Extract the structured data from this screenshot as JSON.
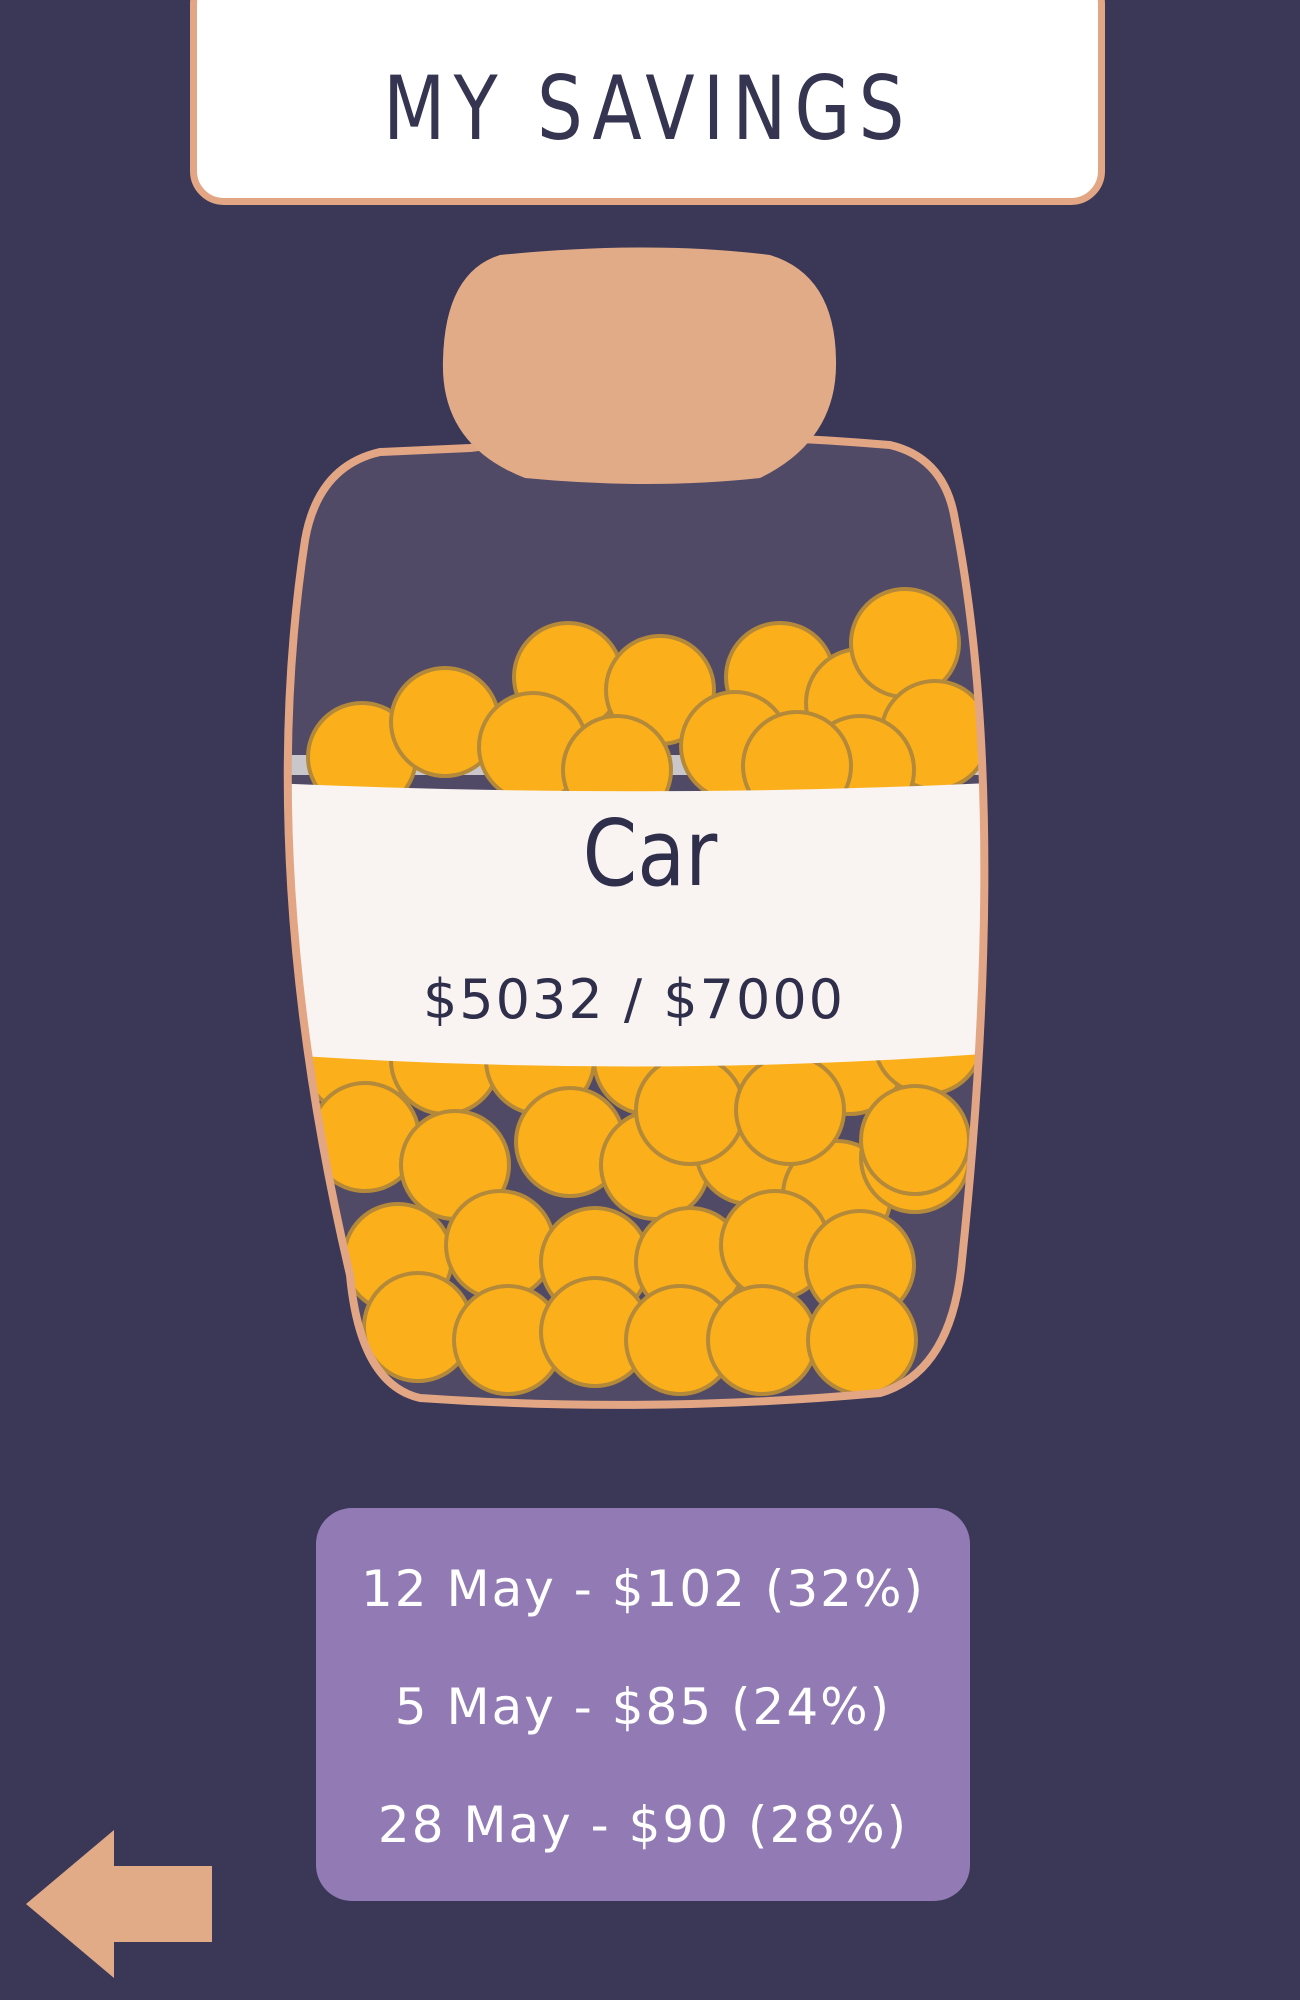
{
  "header": {
    "title": "MY SAVINGS"
  },
  "jar": {
    "goal_name": "Car",
    "progress_text": "$5032 / $7000",
    "saved": 5032,
    "goal": 7000
  },
  "history": [
    {
      "text": "12 May - $102 (32%)"
    },
    {
      "text": "5 May - $85 (24%)"
    },
    {
      "text": "28 May - $90 (28%)"
    }
  ],
  "nav": {
    "back_icon": "arrow-left-icon"
  },
  "colors": {
    "background": "#3a3757",
    "accent": "#e2a684",
    "coin": "#fbb01b",
    "coin_edge": "#b4893a",
    "history_panel": "#927bb5",
    "label_band": "#f9f3f1",
    "text_dark": "#2f2f4c"
  }
}
